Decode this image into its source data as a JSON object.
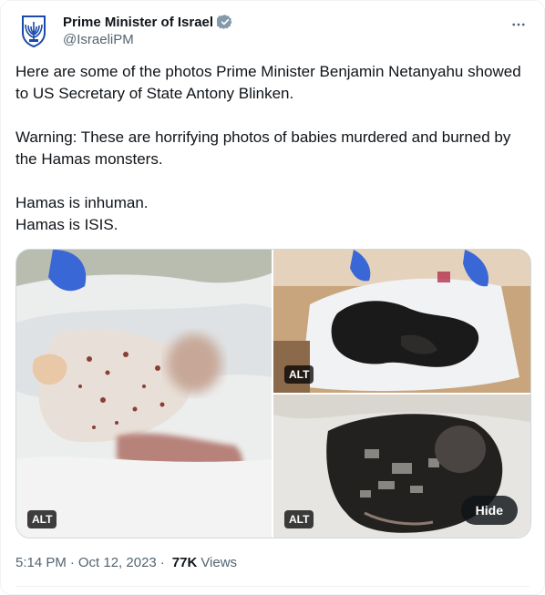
{
  "account": {
    "display_name": "Prime Minister of Israel",
    "handle": "@IsraeliPM",
    "avatar_icon": "menorah-emblem-icon",
    "verified_icon": "verified-badge-icon",
    "verified_color": "#829aab"
  },
  "tweet": {
    "lines": [
      "Here are some of the photos Prime Minister Benjamin Netanyahu showed to US Secretary of State Antony Blinken.",
      "Warning: These are horrifying photos of babies murdered and burned by the Hamas monsters.",
      "Hamas is inhuman.",
      "Hamas is ISIS."
    ]
  },
  "media": {
    "alt_label": "ALT",
    "hide_label": "Hide",
    "photos": [
      {
        "description": "photo-1"
      },
      {
        "description": "photo-2"
      },
      {
        "description": "photo-3"
      }
    ]
  },
  "meta": {
    "time": "5:14 PM",
    "date": "Oct 12, 2023",
    "separator": "·",
    "views_count": "77K",
    "views_label": "Views"
  },
  "colors": {
    "text_primary": "#0f1419",
    "text_secondary": "#536471",
    "border": "#cfd9de"
  }
}
